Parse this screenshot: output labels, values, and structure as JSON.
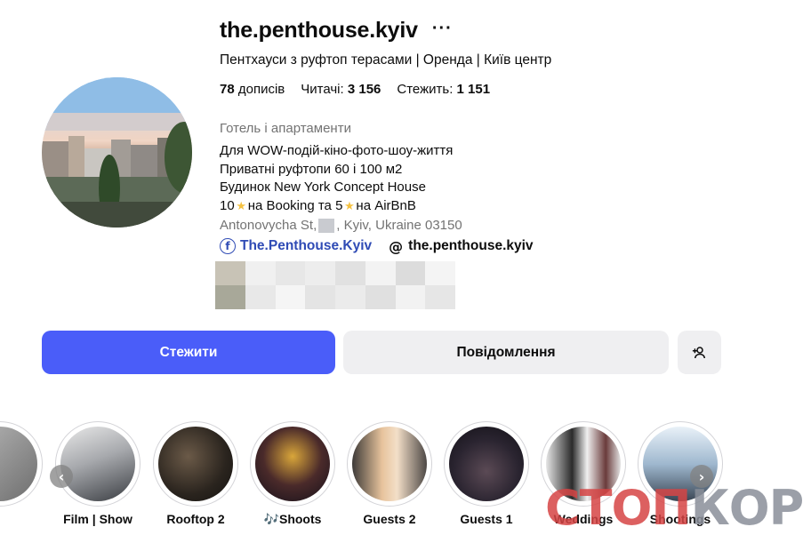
{
  "profile": {
    "username": "the.penthouse.kyiv",
    "more_label": "···",
    "full_name": "Пентхауси з руфтоп терасами | Оренда | Київ центр",
    "stats": [
      {
        "value": "78",
        "label": "дописів",
        "value_first": true
      },
      {
        "label": "Читачі:",
        "value": "3 156",
        "value_first": false
      },
      {
        "label": "Стежить:",
        "value": "1 151",
        "value_first": false
      }
    ],
    "category": "Готель і апартаменти",
    "bio": {
      "line1": "Для WOW-подій-кіно-фото-шоу-життя",
      "line2": "Приватні руфтопи 60 і 100 м2",
      "line3": "Будинок New York Concept House",
      "line4_a": "10",
      "line4_b": "на Booking та 5",
      "line4_c": "на AirBnB",
      "star_glyph": "★"
    },
    "address_a": "Antonovycha St,",
    "address_b": ", Kyiv, Ukraine 03150",
    "links": {
      "facebook": "The.Penthouse.Kyiv",
      "facebook_glyph": "f",
      "threads": "the.penthouse.kyiv",
      "threads_glyph": "@"
    }
  },
  "buttons": {
    "follow": "Стежити",
    "message": "Повідомлення",
    "add_user_glyph": "+👤"
  },
  "highlights": [
    {
      "label": "Film | Show"
    },
    {
      "label": "Rooftop 2"
    },
    {
      "label": "🎶Shoots"
    },
    {
      "label": "Guests 2"
    },
    {
      "label": "Guests 1"
    },
    {
      "label": "Weddings"
    },
    {
      "label": "Shootings"
    }
  ],
  "nav": {
    "prev": "‹",
    "next": "›"
  },
  "watermark": {
    "part_a": "СТОП",
    "part_b": "КОР"
  },
  "colors": {
    "accent": "#4a5df9",
    "link": "#2f4bb5",
    "secondary_text": "#737373",
    "button_bg": "#efeff1"
  }
}
